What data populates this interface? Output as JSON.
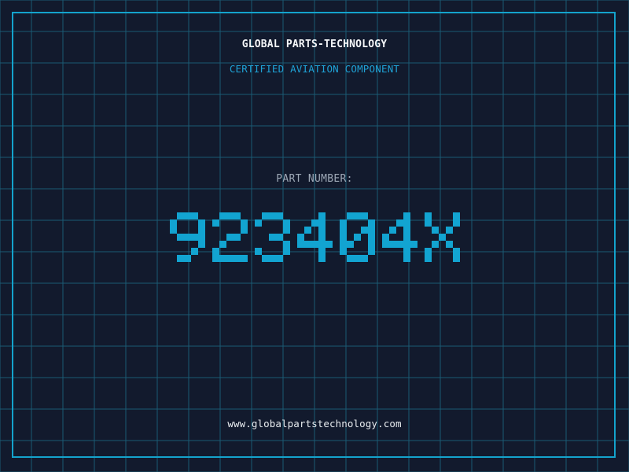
{
  "colors": {
    "background": "#121a2d",
    "grid_line": "#1b5a74",
    "frame": "#14a3cc",
    "company_text": "#f4f6f8",
    "subtitle_text": "#1fa2d6",
    "label_text": "#9ea9b7",
    "part_number": "#12a4d1",
    "url_text": "#e8ecef"
  },
  "header": {
    "company": "GLOBAL PARTS-TECHNOLOGY",
    "subtitle": "CERTIFIED AVIATION COMPONENT"
  },
  "part": {
    "label": "PART NUMBER:",
    "number": "923404X"
  },
  "footer": {
    "url": "www.globalpartstechnology.com"
  }
}
